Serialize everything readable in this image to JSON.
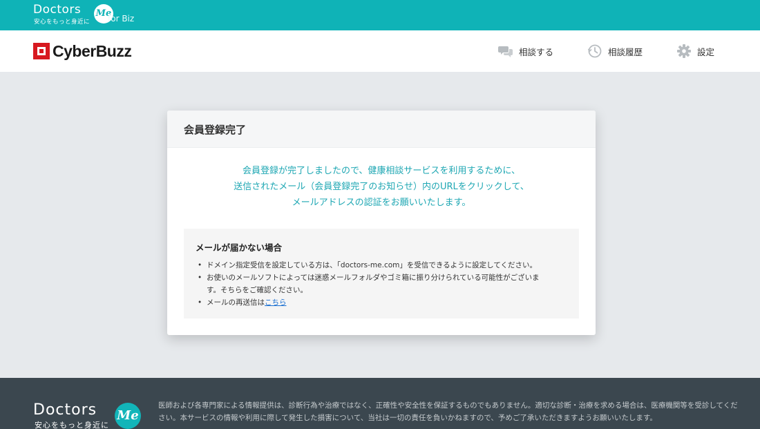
{
  "topbar": {
    "brand_word": "Doctors",
    "brand_circle": "Me",
    "brand_tagline": "安心をもっと身近に",
    "for_biz": "for Biz",
    "background": "#0fb3b7"
  },
  "header": {
    "logo_text": "CyberBuzz",
    "logo_color": "#d71920",
    "nav": [
      {
        "label": "相談する",
        "icon": "chat-bubbles-icon"
      },
      {
        "label": "相談履歴",
        "icon": "clock-history-icon"
      },
      {
        "label": "設定",
        "icon": "gear-icon"
      }
    ]
  },
  "card": {
    "title": "会員登録完了",
    "message_lines": [
      "会員登録が完了しましたので、健康相談サービスを利用するために、",
      "送信されたメール（会員登録完了のお知らせ）内のURLをクリックして、",
      "メールアドレスの認証をお願いいたします。"
    ],
    "accent": "#1ea7b3",
    "notice": {
      "title": "メールが届かない場合",
      "items": [
        "ドメイン指定受信を設定している方は、「doctors-me.com」を受信できるように設定してください。",
        "お使いのメールソフトによっては迷惑メールフォルダやゴミ箱に振り分けられている可能性がございま",
        "す。そちらをご確認ください。"
      ],
      "resend_prefix": "メールの再送信は",
      "resend_link": "こちら"
    }
  },
  "footer": {
    "brand_word": "Doctors",
    "brand_circle": "Me",
    "brand_tagline": "安心をもっと身近に",
    "text": "医師および各専門家による情報提供は、診断行為や治療ではなく、正確性や安全性を保証するものでもありません。適切な診断・治療を求める場合は、医療機関等を受診してください。本サービスの情報や利用に際して発生した損害について、当社は一切の責任を負いかねますので、予めご了承いただきますようお願いいたします。"
  }
}
